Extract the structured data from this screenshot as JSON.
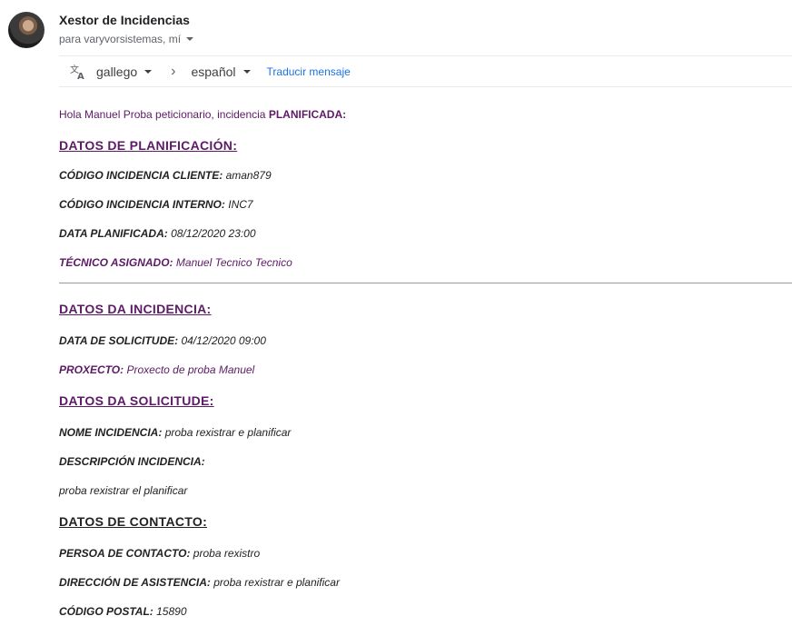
{
  "header": {
    "sender": "Xestor de Incidencias",
    "recipients": "para varyvorsistemas, mí"
  },
  "translate": {
    "source_lang": "gallego",
    "target_lang": "español",
    "link": "Traducir mensaje"
  },
  "message": {
    "greeting_prefix": "Hola Manuel Proba peticionario, incidencia ",
    "greeting_status": "PLANIFICADA:",
    "sections": {
      "planificacion": {
        "title": "DATOS DE PLANIFICACIÓN:",
        "codigo_cliente_label": "CÓDIGO INCIDENCIA CLIENTE:",
        "codigo_cliente_value": "aman879",
        "codigo_interno_label": "CÓDIGO INCIDENCIA INTERNO:",
        "codigo_interno_value": "INC7",
        "data_planificada_label": "DATA PLANIFICADA:",
        "data_planificada_value": "08/12/2020 23:00",
        "tecnico_label": "TÉCNICO ASIGNADO:",
        "tecnico_value": "Manuel Tecnico Tecnico"
      },
      "incidencia": {
        "title": "DATOS DA INCIDENCIA:",
        "data_solicitude_label": "DATA DE SOLICITUDE:",
        "data_solicitude_value": "04/12/2020 09:00",
        "proxecto_label": "PROXECTO:",
        "proxecto_value": "Proxecto de proba Manuel"
      },
      "solicitude": {
        "title": "DATOS DA SOLICITUDE:",
        "nome_label": "NOME INCIDENCIA:",
        "nome_value": "proba rexistrar e planificar",
        "descricion_label": "DESCRIPCIÓN INCIDENCIA:",
        "descricion_value": "proba rexistrar el planificar"
      },
      "contacto": {
        "title": "DATOS DE CONTACTO:",
        "persoa_label": "PERSOA DE CONTACTO:",
        "persoa_value": "proba rexistro",
        "direccion_label": "DIRECCIÓN DE ASISTENCIA:",
        "direccion_value": "proba rexistrar e planificar",
        "postal_label": "CÓDIGO POSTAL:",
        "postal_value": "15890"
      }
    }
  },
  "colors": {
    "accent_purple": "#5d1a66",
    "link_blue": "#1a73e8"
  },
  "icons": {
    "translate": "translate-icon",
    "chevron": "chevron-right-icon",
    "dropdown": "caret-down-icon"
  }
}
